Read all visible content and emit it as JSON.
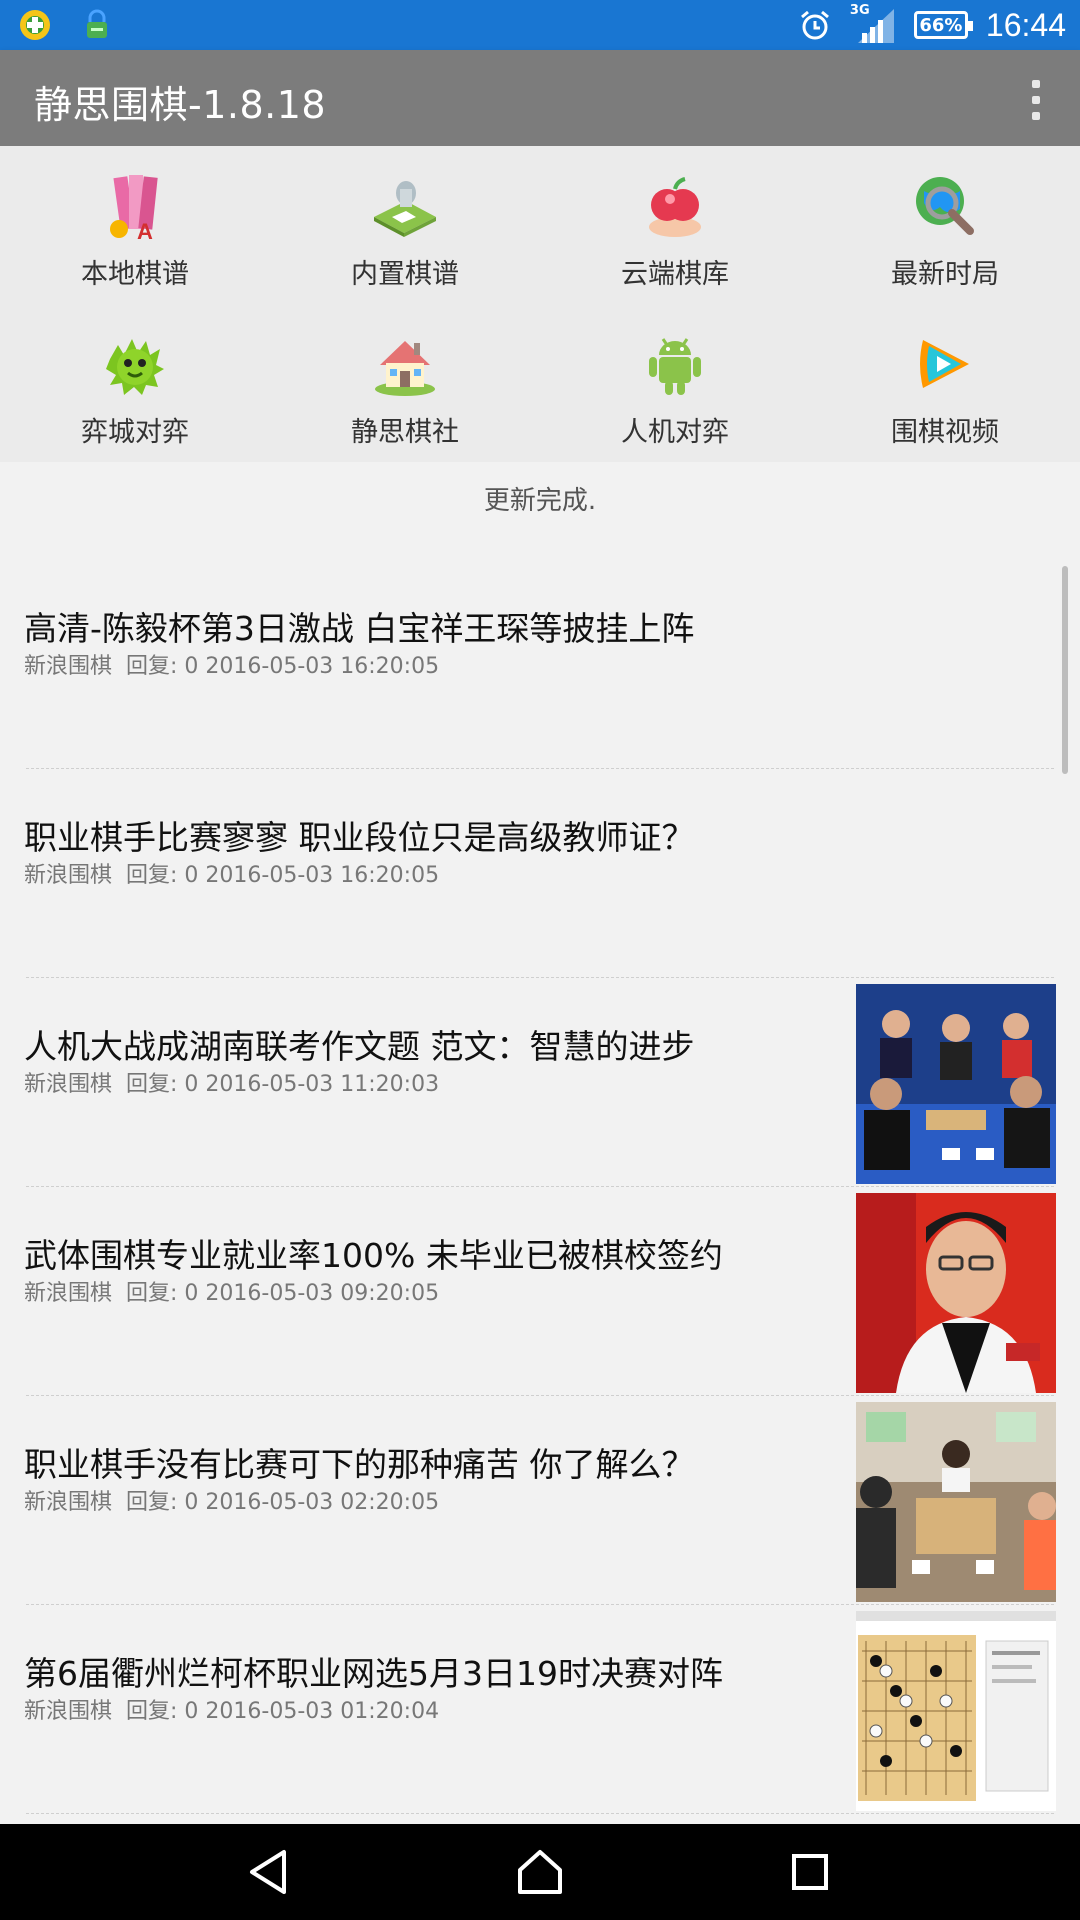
{
  "status_bar": {
    "network": "3G",
    "battery": "66%",
    "time": "16:44",
    "icons": [
      "app-notification-icon",
      "lock-notification-icon",
      "alarm-icon",
      "signal-icon",
      "battery-icon"
    ]
  },
  "app_bar": {
    "title": "静思围棋-1.8.18",
    "menu_icon": "overflow-menu-icon"
  },
  "features": [
    {
      "label": "本地棋谱",
      "icon": "books-icon"
    },
    {
      "label": "内置棋谱",
      "icon": "floppy-disk-icon"
    },
    {
      "label": "云端棋库",
      "icon": "apple-icon"
    },
    {
      "label": "最新时局",
      "icon": "globe-search-icon"
    },
    {
      "label": "弈城对弈",
      "icon": "dragon-icon"
    },
    {
      "label": "静思棋社",
      "icon": "house-icon"
    },
    {
      "label": "人机对弈",
      "icon": "android-icon"
    },
    {
      "label": "围棋视频",
      "icon": "play-icon"
    }
  ],
  "update_status": "更新完成.",
  "news": [
    {
      "title": "高清-陈毅杯第3日激战 白宝祥王琛等披挂上阵",
      "source": "新浪围棋",
      "meta": "回复: 0 2016-05-03 16:20:05",
      "has_thumb": false
    },
    {
      "title": "职业棋手比赛寥寥 职业段位只是高级教师证？",
      "source": "新浪围棋",
      "meta": "回复: 0 2016-05-03 16:20:05",
      "has_thumb": false
    },
    {
      "title": "人机大战成湖南联考作文题 范文：智慧的进步",
      "source": "新浪围棋",
      "meta": "回复: 0 2016-05-03 11:20:03",
      "has_thumb": true
    },
    {
      "title": "武体围棋专业就业率100% 未毕业已被棋校签约",
      "source": "新浪围棋",
      "meta": "回复: 0 2016-05-03 09:20:05",
      "has_thumb": true
    },
    {
      "title": "职业棋手没有比赛可下的那种痛苦 你了解么？",
      "source": "新浪围棋",
      "meta": "回复: 0 2016-05-03 02:20:05",
      "has_thumb": true
    },
    {
      "title": "第6届衢州烂柯杯职业网选5月3日19时决赛对阵",
      "source": "新浪围棋",
      "meta": "回复: 0 2016-05-03 01:20:04",
      "has_thumb": true
    }
  ],
  "nav_bar": {
    "icons": [
      "back-icon",
      "home-icon",
      "recents-icon"
    ]
  }
}
